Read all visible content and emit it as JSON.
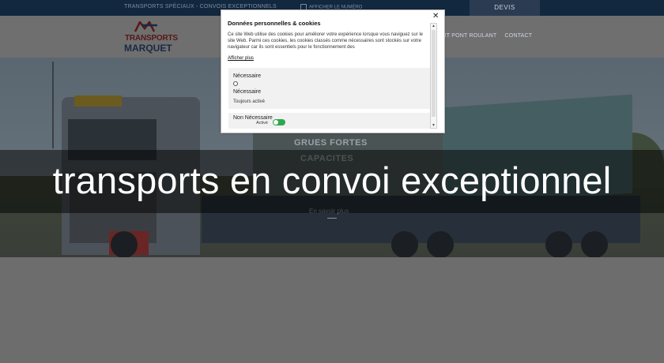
{
  "topbar": {
    "tagline": "TRANSPORTS SPÉCIAUX - CONVOIS EXCEPTIONNELS",
    "phone": "AFFICHER LE NUMÉRO",
    "devis": "DEVIS"
  },
  "header": {
    "logo_line1": "TRANSPORTS",
    "logo_line2": "MARQUET",
    "nav": [
      "ORT PONT ROULANT",
      "CONTACT"
    ]
  },
  "hero": {
    "text1": "GRUES FORTES",
    "text2": "CAPACITES",
    "link": "En savoir plus"
  },
  "banner": {
    "title": "transports en convoi exceptionnel"
  },
  "cookie_dialog": {
    "title": "Données personnelles & cookies",
    "description": "Ce site Web utilise des cookies pour améliorer votre expérience lorsque vous naviguez sur le site Web. Parmi ces cookies, les cookies classés comme nécessaires sont stockés sur votre navigateur car ils sont essentiels pour le fonctionnement des",
    "more_link": "Afficher plus",
    "necessary_title": "Nécessaire",
    "necessary_label": "Nécessaire",
    "necessary_status": "Toujours activé",
    "non_necessary_title": "Non Nécessaire",
    "non_necessary_status": "Activé",
    "close_symbol": "✕"
  },
  "colors": {
    "toggle_on": "#2fa84f",
    "topbar": "#12283f"
  }
}
